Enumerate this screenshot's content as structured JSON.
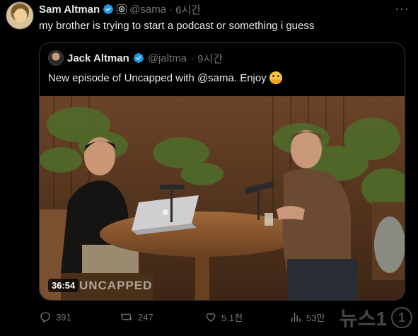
{
  "tweet": {
    "author_name": "Sam Altman",
    "handle": "@sama",
    "separator": "·",
    "time": "6시간",
    "text": "my brother is trying to start a podcast or something i guess",
    "more_icon": "more-icon"
  },
  "quote": {
    "author_name": "Jack Altman",
    "handle": "@jaltma",
    "separator": "·",
    "time": "9시간",
    "text": "New episode of Uncapped with @sama. Enjoy",
    "emoji": "hugging-face-emoji",
    "video": {
      "duration": "36:54",
      "brand_overlay": "UNCAPPED"
    }
  },
  "actions": {
    "replies": "391",
    "retweets": "247",
    "likes": "5.1천",
    "views": "53만"
  },
  "watermark": {
    "text": "뉴스1",
    "badge": "1"
  },
  "colors": {
    "background": "#000000",
    "text_primary": "#e7e9ea",
    "text_secondary": "#71767b",
    "verified": "#1d9bf0",
    "border": "#2f3336"
  }
}
